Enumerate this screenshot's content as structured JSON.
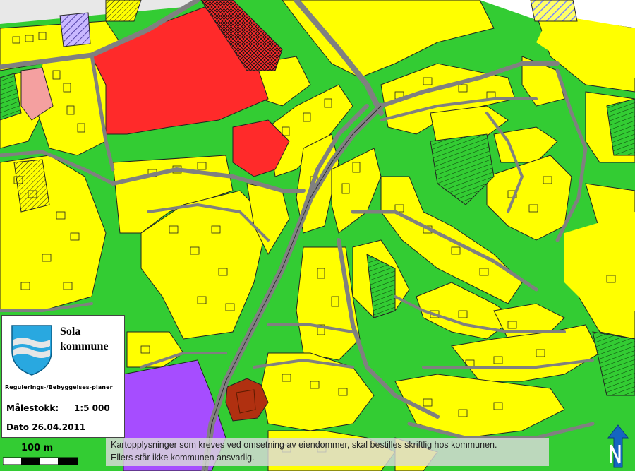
{
  "map": {
    "description_colors": {
      "background_green": "#33cc33",
      "residential_yellow": "#ffff00",
      "public_red": "#ff2a2a",
      "pink": "#f4a0a0",
      "purple": "#a64dff",
      "brown": "#b03010",
      "road_grey": "#7f7f7f",
      "building_outline": "#000000"
    }
  },
  "legend": {
    "municipality_line1": "Sola",
    "municipality_line2": "kommune",
    "plan_type": "Regulerings-/Bebyggelses-planer",
    "scale_label": "Målestokk:",
    "scale_value": "1:5 000",
    "date_text": "Dato 26.04.2011",
    "crest_icon": "sola-coat-of-arms-icon"
  },
  "scalebar": {
    "label": "100 m"
  },
  "disclaimer": {
    "line1": "Kartopplysninger som kreves ved omsetning av eiendommer, skal bestilles skriftlig hos kommunen.",
    "line2": "Ellers står ikke kommunen ansvarlig."
  },
  "north_arrow": {
    "icon": "north-arrow-icon"
  }
}
